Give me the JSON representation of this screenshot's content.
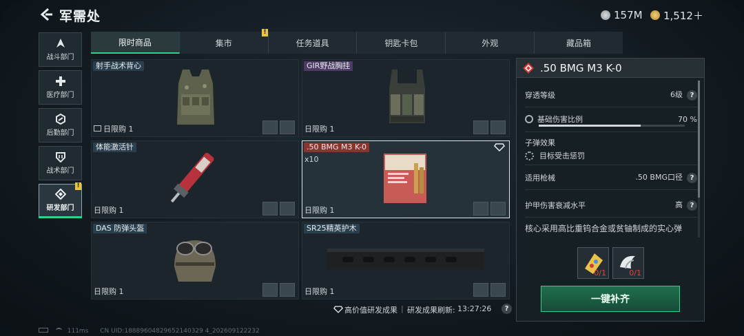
{
  "header": {
    "title": "军需处",
    "currency1": "157M",
    "currency2": "1,512＋"
  },
  "sidebar": {
    "items": [
      {
        "label": "战斗部门"
      },
      {
        "label": "医疗部门"
      },
      {
        "label": "后勤部门"
      },
      {
        "label": "战术部门"
      },
      {
        "label": "研发部门",
        "badge": "!"
      }
    ]
  },
  "tabs": [
    {
      "label": "限时商品"
    },
    {
      "label": "集市",
      "badge": "!"
    },
    {
      "label": "任务道具"
    },
    {
      "label": "钥匙卡包"
    },
    {
      "label": "外观"
    },
    {
      "label": "藏品箱"
    }
  ],
  "grid": {
    "items": [
      {
        "name": "射手战术背心",
        "limit": "日限购 1"
      },
      {
        "name": "GIR野战胸挂",
        "limit": "日限购 1"
      },
      {
        "name": "体能激活针",
        "limit": "日限购 1"
      },
      {
        "name": ".50 BMG M3 K-0",
        "limit": "日限购 1",
        "qty": "x10"
      },
      {
        "name": "DAS 防弹头盔",
        "limit": "日限购 1"
      },
      {
        "name": "SR25精英护木",
        "limit": "日限购 1"
      }
    ]
  },
  "detail": {
    "title": ".50 BMG M3 K-0",
    "penetration_label": "穿透等级",
    "penetration_value": "6级",
    "damage_label": "基础伤害比例",
    "damage_value": "70 %",
    "damage_fraction": 0.7,
    "bullet_effect_label": "子弹效果",
    "bullet_effect_value": "目标受击惩罚",
    "weapon_label": "适用枪械",
    "weapon_value": ".50 BMG口径",
    "armor_label": "护甲伤害衰减水平",
    "armor_value": "高",
    "description": "核心采用高比重钨合金或贫铀制成的实心弹",
    "cost1": "0/1",
    "cost2": "0/1",
    "supply_label": "一键补齐"
  },
  "footer": {
    "high_value": "高价值研发成果",
    "refresh_label": "研发成果刷新:",
    "refresh_time": "13:27:26"
  },
  "status": {
    "ping": "111ms",
    "uid": "CN UID:18889604829652140329 4_202609122232"
  }
}
